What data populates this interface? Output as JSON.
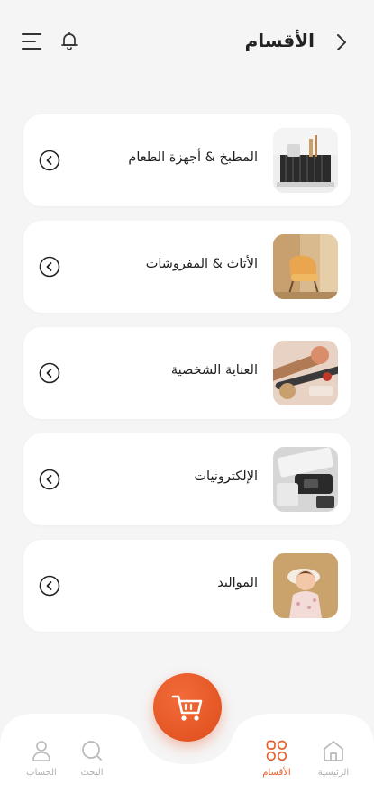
{
  "header": {
    "title": "الأقسام"
  },
  "categories": [
    {
      "label": "المطبخ & أجهزة الطعام",
      "image": "kitchen-dish-rack"
    },
    {
      "label": "الأثاث & المفروشات",
      "image": "furniture-chair"
    },
    {
      "label": "العناية الشخصية",
      "image": "makeup-brushes"
    },
    {
      "label": "الإلكترونيات",
      "image": "electronics-devices"
    },
    {
      "label": "المواليد",
      "image": "child-dress"
    }
  ],
  "nav": {
    "home": "الرئيسية",
    "categories": "الأقسام",
    "search": "البحث",
    "account": "الحساب"
  },
  "colors": {
    "accent": "#e85d2c",
    "background": "#f5f5f5",
    "card": "#ffffff",
    "inactive": "#b0b0b0"
  }
}
